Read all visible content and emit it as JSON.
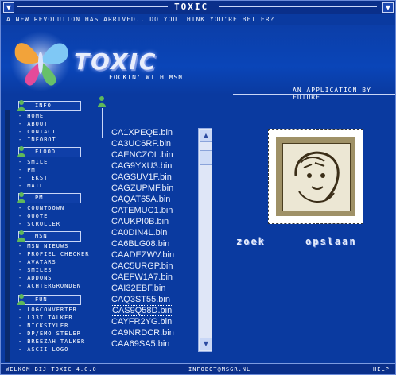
{
  "window": {
    "title": "TOXIC",
    "menu_glyph": "▼",
    "close_glyph": "▼"
  },
  "header": {
    "tagline": "A NEW REVOLUTION HAS ARRIVED.. DO YOU THINK YOU'RE BETTER?",
    "logo": "TOXIC",
    "logo_sub": "FOCKIN' WITH MSN",
    "app_by": "AN APPLICATION BY FUTURE"
  },
  "sidebar": {
    "categories": [
      {
        "label": "INFO",
        "items": [
          "HOME",
          "ABOUT",
          "CONTACT",
          "INFOBOT"
        ]
      },
      {
        "label": "FLOOD",
        "items": [
          "SMILE",
          "PM",
          "TEKST",
          "MAIL"
        ]
      },
      {
        "label": "PM",
        "items": [
          "COUNTDOWN",
          "QUOTE",
          "SCROLLER"
        ]
      },
      {
        "label": "MSN",
        "items": [
          "MSN NIEUWS",
          "PROFIEL CHECKER",
          "AVATARS",
          "SMILES",
          "ADDONS",
          "ACHTERGRONDEN"
        ]
      },
      {
        "label": "FUN",
        "items": [
          "LOGCONVERTER",
          "L33T TALKER",
          "NICKSTYLER",
          "DP/EMO STELER",
          "BREEZAH TALKER",
          "ASCII LOGO"
        ]
      }
    ],
    "bullet": "-"
  },
  "files": [
    "CA1XPEQE.bin",
    "CA3UC6RP.bin",
    "CAENCZOL.bin",
    "CAG9YXU3.bin",
    "CAGSUV1F.bin",
    "CAGZUPMF.bin",
    "CAQAT65A.bin",
    "CATEMUC1.bin",
    "CAUKPI0B.bin",
    "CA0DIN4L.bin",
    "CA6BLG08.bin",
    "CAADEZWV.bin",
    "CAC5URGP.bin",
    "CAEFW1A7.bin",
    "CAI32EBF.bin",
    "CAQ3ST55.bin",
    "CAS9Q58D.bin",
    "CAYFR2YG.bin",
    "CA9NRDCR.bin",
    "CAA69SA5.bin"
  ],
  "selected_file": "CAS9Q58D.bin",
  "actions": {
    "search": "zoek",
    "save": "opslaan"
  },
  "status": {
    "left": "WELKOM BIJ TOXIC 4.0.0",
    "center": "INFOBOT@MSGR.NL",
    "right": "HELP"
  },
  "colors": {
    "background": "#0a3aa0",
    "accent": "#c9d6f7"
  },
  "icons": [
    "menu-icon",
    "close-icon",
    "butterfly-logo-icon",
    "msn-buddy-icon",
    "scroll-up-icon",
    "scroll-down-icon"
  ]
}
